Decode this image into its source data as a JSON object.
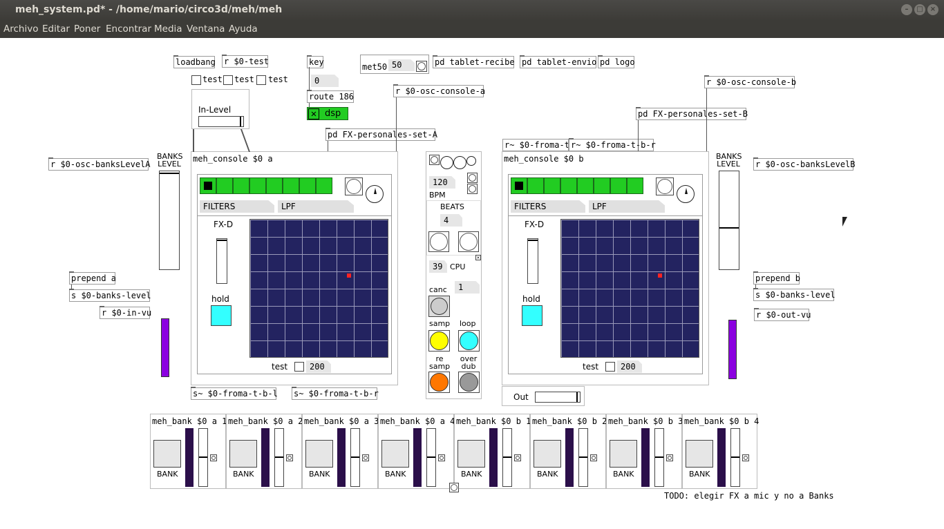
{
  "window": {
    "title": "meh_system.pd* - /home/mario/circo3d/meh/meh"
  },
  "menu": {
    "items": [
      "Archivo",
      "Editar",
      "Poner",
      "Encontrar",
      "Media",
      "Ventana",
      "Ayuda"
    ]
  },
  "objects": {
    "loadbang": "loadbang",
    "r_test": "r $0-test",
    "key": "key",
    "key_num": "0",
    "route": "route 186",
    "dsp_label": "dsp",
    "met50": "met50",
    "met50_num": "50",
    "tablet_recibe": "pd tablet-recibe",
    "tablet_envio": "pd tablet-envio",
    "pd_logo": "pd logo",
    "osc_console_a": "r $0-osc-console-a",
    "osc_console_b": "r $0-osc-console-b",
    "fx_set_a": "pd FX-personales-set-A",
    "fx_set_b": "pd FX-personales-set-B",
    "froma_t_left": "r~ $0-froma-t-",
    "froma_t_b_r": "r~ $0-froma-t-b-r",
    "test1": "test",
    "test2": "test",
    "test3": "test",
    "in_level": "In-Level",
    "banks_level_a_recv": "r $0-osc-banksLevelA",
    "banks_level_b_recv": "r $0-osc-banksLevelB",
    "banks_level_label_a": "BANKS LEVEL",
    "banks_level_label_b": "BANKS LEVEL",
    "prepend_a": "prepend a",
    "prepend_b": "prepend b",
    "s_banks_level_a": "s $0-banks-level",
    "s_banks_level_b": "s $0-banks-level",
    "r_in_vu": "r $0-in-vu",
    "r_out_vu": "r $0-out-vu",
    "s_froma_t_b_l": "s~ $0-froma-t-b-l",
    "s_froma_t_b_r": "s~ $0-froma-t-b-r",
    "out_label": "Out",
    "todo": "TODO: elegir FX a mic y no a Banks"
  },
  "console_a": {
    "title": "meh_console $0 a",
    "filters": "FILTERS",
    "lpf": "LPF",
    "fxd": "FX-D",
    "hold": "hold",
    "test": "test",
    "test_num": "200"
  },
  "console_b": {
    "title": "meh_console $0 b",
    "filters": "FILTERS",
    "lpf": "LPF",
    "fxd": "FX-D",
    "hold": "hold",
    "test": "test",
    "test_num": "200"
  },
  "center_panel": {
    "bpm_num": "120",
    "bpm_label": "BPM",
    "beats_label": "BEATS",
    "beats_num": "4",
    "cpu_num": "39",
    "cpu_label": "CPU",
    "canc_label": "canc",
    "canc_num": "1",
    "samp_label": "samp",
    "loop_label": "loop",
    "resamp_label": "re samp",
    "overdub_label": "over dub"
  },
  "banks": [
    {
      "title": "meh_bank $0 a 1",
      "label": "BANK"
    },
    {
      "title": "meh_bank $0 a 2",
      "label": "BANK"
    },
    {
      "title": "meh_bank $0 a 3",
      "label": "BANK"
    },
    {
      "title": "meh_bank $0 a 4",
      "label": "BANK"
    },
    {
      "title": "meh_bank $0 b 1",
      "label": "BANK"
    },
    {
      "title": "meh_bank $0 b 2",
      "label": "BANK"
    },
    {
      "title": "meh_bank $0 b 3",
      "label": "BANK"
    },
    {
      "title": "meh_bank $0 b 4",
      "label": "BANK"
    }
  ],
  "colors": {
    "green": "#22cc22",
    "cyan": "#33ffff",
    "yellow": "#ffff00",
    "orange": "#ff7700",
    "gray": "#999999",
    "grid": "#232360",
    "vu": "#8b00e0"
  }
}
